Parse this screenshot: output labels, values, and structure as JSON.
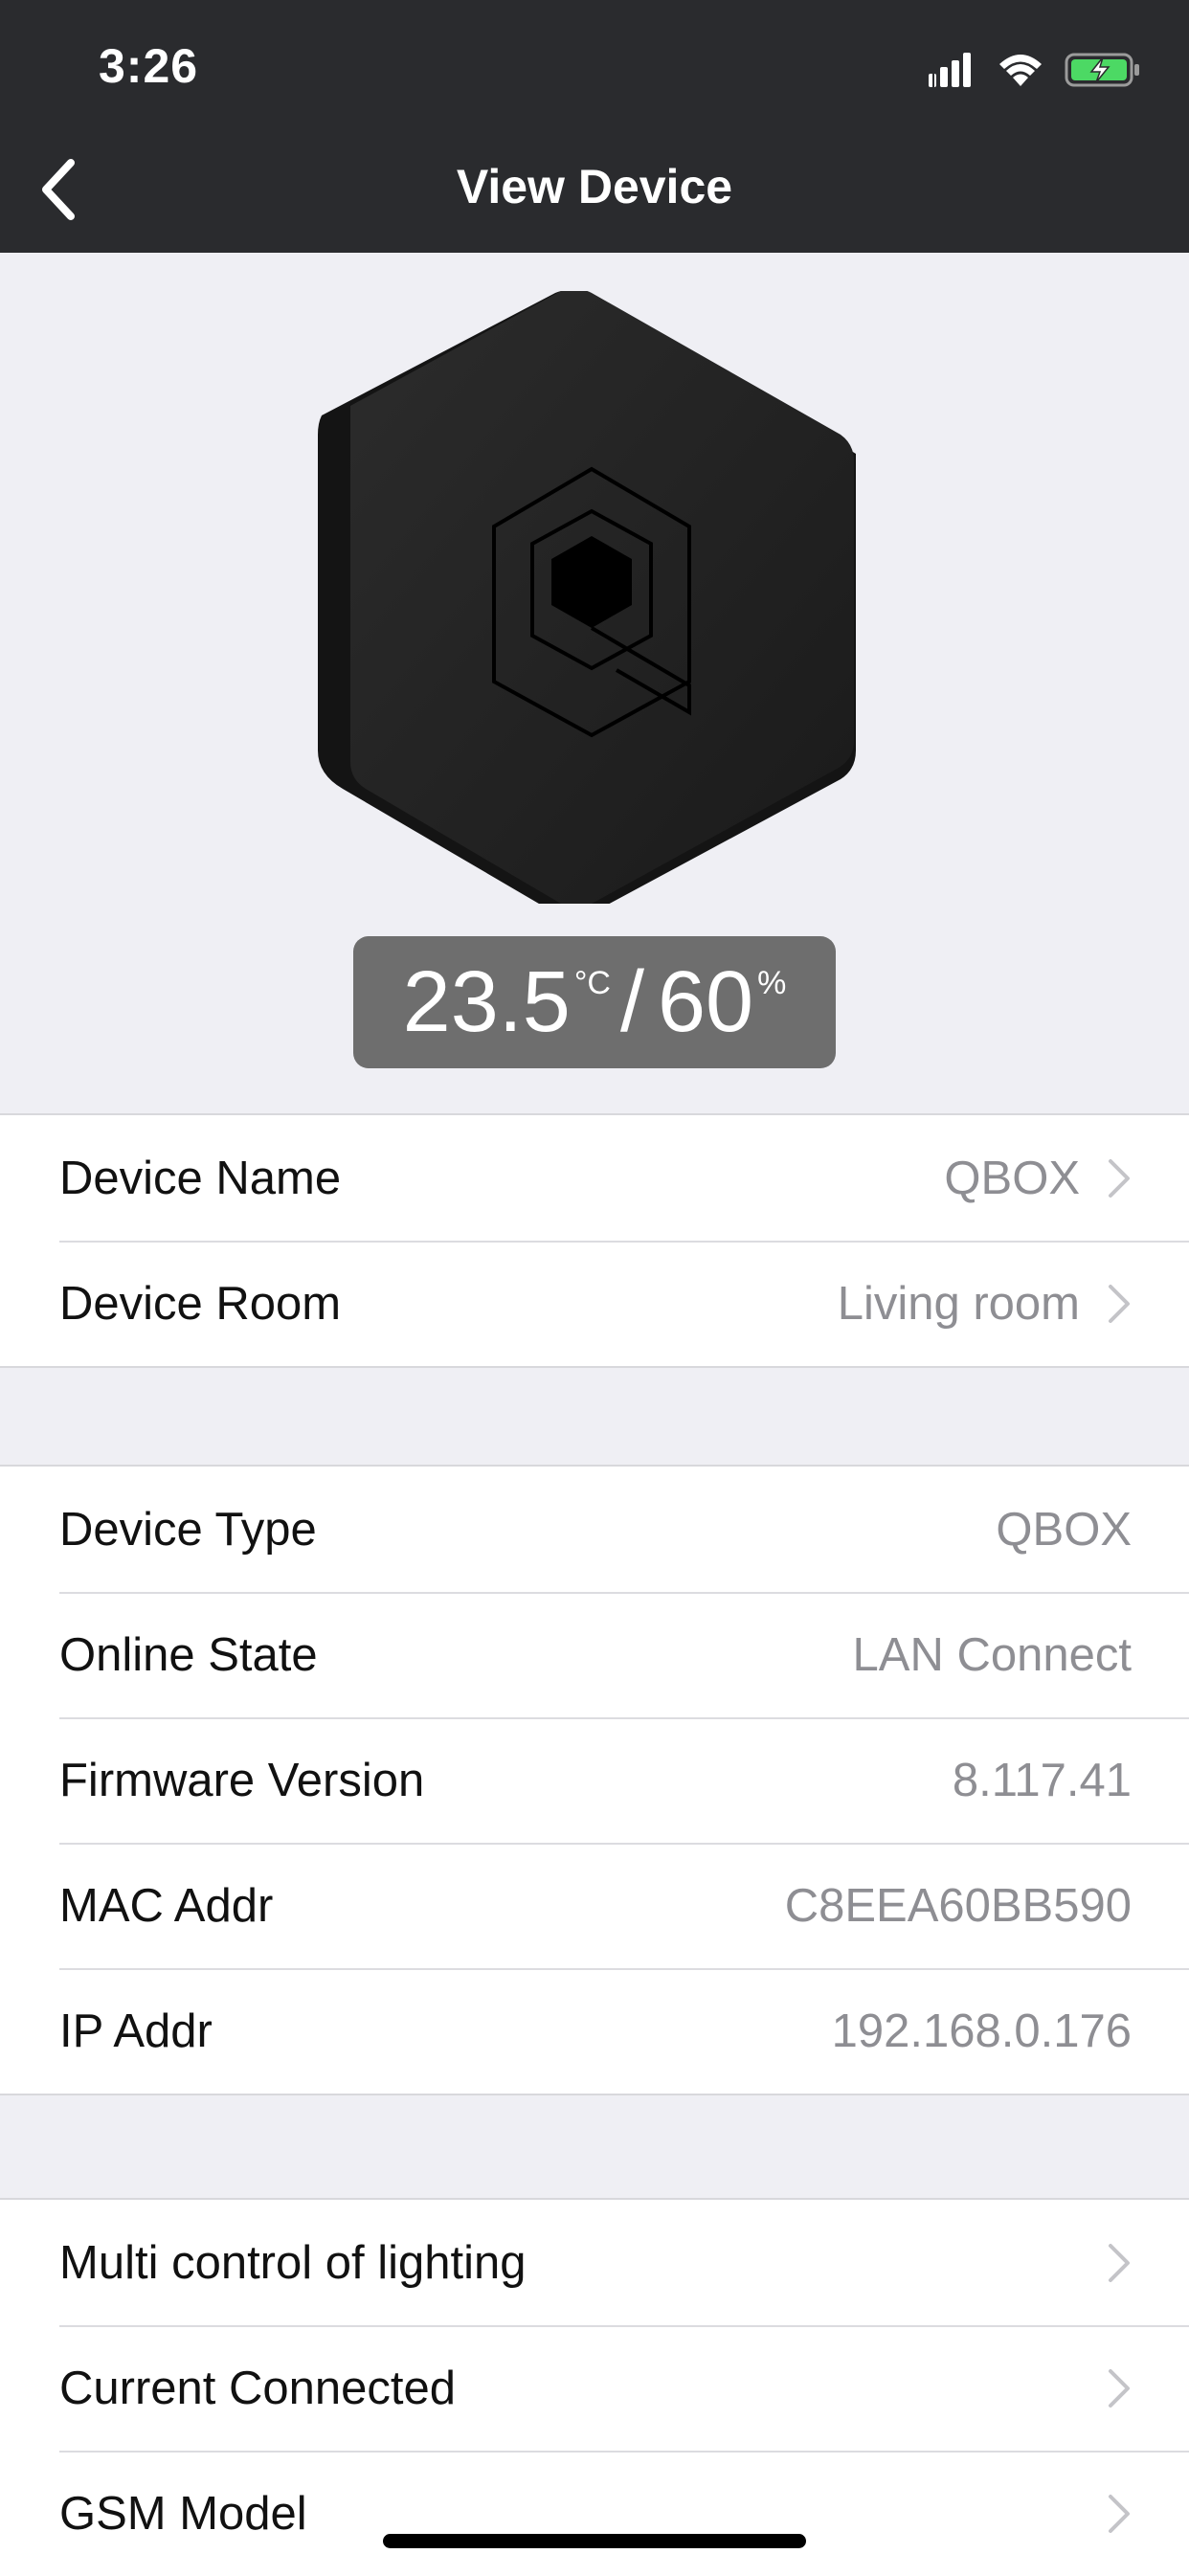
{
  "status_bar": {
    "time": "3:26",
    "icons": [
      "signal-icon",
      "wifi-icon",
      "battery-charging-icon"
    ]
  },
  "nav": {
    "title": "View Device",
    "back_icon": "chevron-left-icon"
  },
  "sensor": {
    "temperature": "23.5",
    "temperature_unit": "°C",
    "separator": "/",
    "humidity": "60",
    "humidity_unit": "%"
  },
  "group1": {
    "rows": [
      {
        "label": "Device Name",
        "value": "QBOX"
      },
      {
        "label": "Device Room",
        "value": "Living room"
      }
    ]
  },
  "group2": {
    "rows": [
      {
        "label": "Device Type",
        "value": "QBOX"
      },
      {
        "label": "Online State",
        "value": "LAN Connect"
      },
      {
        "label": "Firmware Version",
        "value": "8.117.41"
      },
      {
        "label": "MAC Addr",
        "value": "C8EEA60BB590"
      },
      {
        "label": "IP Addr",
        "value": "192.168.0.176"
      }
    ]
  },
  "group3": {
    "rows": [
      {
        "label": "Multi control of lighting"
      },
      {
        "label": "Current Connected"
      },
      {
        "label": "GSM Model"
      }
    ]
  },
  "colors": {
    "header_bg": "#2a2b2e",
    "page_bg": "#efeff4",
    "value_gray": "#8e8e93",
    "sensor_bg": "#6e6e6e",
    "battery_green": "#4cd964"
  }
}
